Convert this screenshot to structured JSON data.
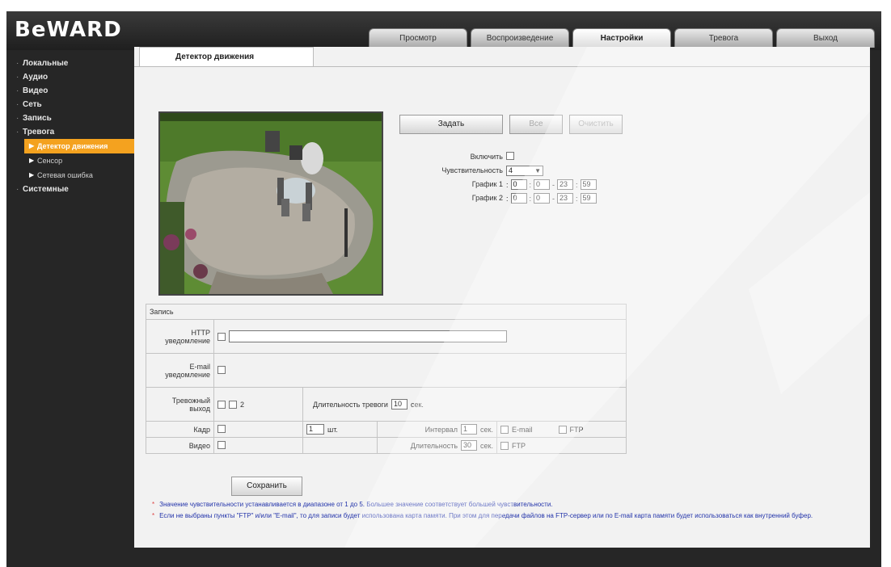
{
  "brand": {
    "logo": "BeWARD"
  },
  "nav_tabs": [
    {
      "label": "Просмотр",
      "active": false
    },
    {
      "label": "Воспроизведение",
      "active": false
    },
    {
      "label": "Настройки",
      "active": true
    },
    {
      "label": "Тревога",
      "active": false
    },
    {
      "label": "Выход",
      "active": false
    }
  ],
  "sidebar": {
    "items": [
      {
        "label": "Локальные"
      },
      {
        "label": "Аудио"
      },
      {
        "label": "Видео"
      },
      {
        "label": "Сеть"
      },
      {
        "label": "Запись"
      },
      {
        "label": "Тревога"
      }
    ],
    "sub_items": [
      {
        "label": "Детектор движения",
        "active": true
      },
      {
        "label": "Сенсор",
        "active": false
      },
      {
        "label": "Сетевая ошибка",
        "active": false
      }
    ],
    "last_item": {
      "label": "Системные"
    }
  },
  "content_tab": "Детектор движения",
  "buttons": {
    "set": "Задать",
    "all": "Все",
    "clear": "Очистить",
    "save": "Сохранить"
  },
  "form": {
    "enable_label": "Включить",
    "sensitivity_label": "Чувствительность",
    "sensitivity_value": "4",
    "schedule1_label": "График 1",
    "schedule1": [
      "0",
      "0",
      "23",
      "59"
    ],
    "schedule2_label": "График 2",
    "schedule2": [
      "0",
      "0",
      "23",
      "59"
    ]
  },
  "event": {
    "header": "Запись",
    "http_label": "HTTP уведомление",
    "http_value": "",
    "email_label": "E-mail уведомление",
    "alarm_out_label": "Тревожный выход",
    "alarm_out_check2_label": "2",
    "duration_label": "Длительность тревоги",
    "duration_value": "10",
    "sec": "сек.",
    "frame_label": "Кадр",
    "frame_count": "1",
    "frame_unit": "шт.",
    "interval_label": "Интервал",
    "interval_value": "1",
    "email_opt": "E-mail",
    "ftp_opt": "FTP",
    "video_label": "Видео",
    "video_duration_label": "Длительность",
    "video_duration_value": "30"
  },
  "notes": [
    "Значение чувствительности устанавливается в диапазоне от 1 до 5. Большее значение соответствует большей чувствительности.",
    "Если не выбраны пункты \"FTP\" и/или \"E-mail\", то для записи будет использована карта памяти. При этом для передачи файлов на FTP-сервер или по E-mail карта памяти будет использоваться как внутренний буфер."
  ],
  "colors": {
    "active_sidebar": "#f4a21f",
    "note_text": "#2233aa",
    "note_star": "#dd4444"
  }
}
